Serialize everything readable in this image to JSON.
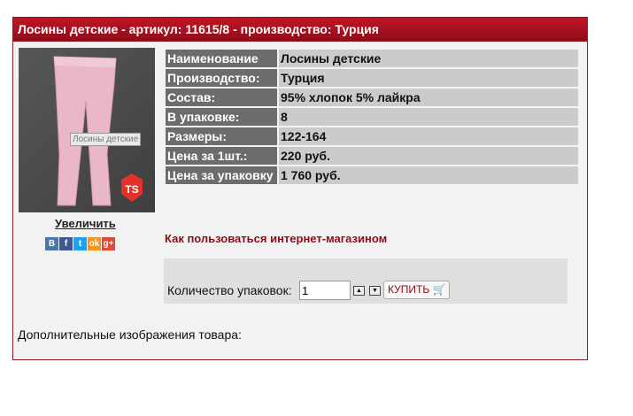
{
  "header": {
    "title": "Лосины детские - артикул: 11615/8 - производство: Турция"
  },
  "photo": {
    "caption": "Лосины детские",
    "zoom_label": "Увеличить",
    "logo_text": "TS"
  },
  "social": [
    {
      "name": "vk-icon",
      "glyph": "В",
      "color": "#4a76a8"
    },
    {
      "name": "facebook-icon",
      "glyph": "f",
      "color": "#3b5998"
    },
    {
      "name": "twitter-icon",
      "glyph": "t",
      "color": "#1da1f2"
    },
    {
      "name": "odnoklassniki-icon",
      "glyph": "ok",
      "color": "#f7931e"
    },
    {
      "name": "googleplus-icon",
      "glyph": "g+",
      "color": "#dd4b39"
    }
  ],
  "props": [
    {
      "key": "Наименование",
      "value": "Лосины детские"
    },
    {
      "key": "Производство:",
      "value": "Турция"
    },
    {
      "key": "Состав:",
      "value": "95% хлопок 5% лайкра"
    },
    {
      "key": "В упаковке:",
      "value": "8"
    },
    {
      "key": "Размеры:",
      "value": "122-164"
    },
    {
      "key": "Цена за 1шт.:",
      "value": "220 руб."
    },
    {
      "key": "Цена за упаковку",
      "value": "1 760 руб."
    }
  ],
  "how_link": "Как пользоваться интернет-магазином",
  "buy": {
    "qty_label": "Количество упаковок:",
    "qty_value": "1",
    "button_label": "КУПИТЬ"
  },
  "extra_images_label": "Дополнительные изображения товара:"
}
